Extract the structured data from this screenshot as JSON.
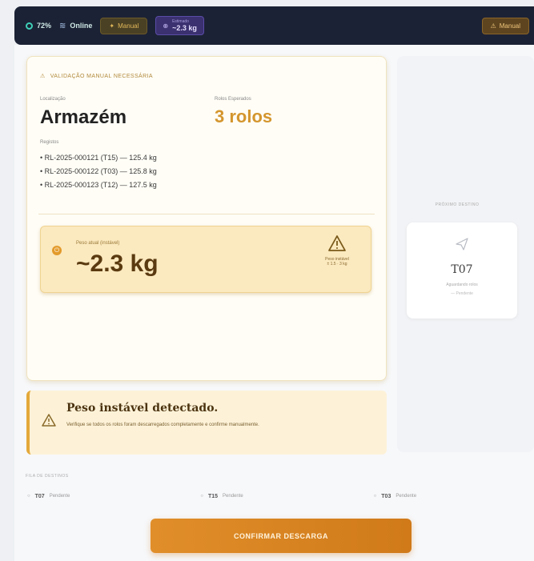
{
  "topbar": {
    "battery": "72%",
    "status": "Online",
    "manual_label": "Manual",
    "estimate_label": "Estimado",
    "estimate_value": "~2.3 kg",
    "right_label": "Manual"
  },
  "card": {
    "header": "VALIDAÇÃO MANUAL NECESSÁRIA",
    "location_label": "Localização",
    "location": "Armazém",
    "rolls_label": "Rolos Esperados",
    "rolls": "3 rolos",
    "rolls_list_label": "Registos",
    "rolls_list": [
      "• RL-2025-000121 (T15) — 125.4 kg",
      "• RL-2025-000122 (T03) — 125.8 kg",
      "• RL-2025-000123 (T12) — 127.5 kg"
    ],
    "weight_label": "Peso atual (instável)",
    "weight_value": "~2.3 kg",
    "weight_warn_1": "Peso instável",
    "weight_warn_2": "± 1.5 · 3 kg"
  },
  "side": {
    "label": "PRÓXIMO DESTINO",
    "code": "T07",
    "sub1": "Aguardando rolos",
    "sub2": "— Pendente"
  },
  "alert": {
    "title": "Peso instável detectado.",
    "text": "Verifique se todos os rolos foram descarregados completamente e confirme manualmente."
  },
  "tracks": {
    "label": "FILA DE DESTINOS",
    "items": [
      {
        "code": "T07",
        "status": "Pendente"
      },
      {
        "code": "T15",
        "status": "Pendente"
      },
      {
        "code": "T03",
        "status": "Pendente"
      }
    ]
  },
  "confirm_label": "CONFIRMAR DESCARGA",
  "colors": {
    "accent": "#e08e2a",
    "topbar": "#1c2235",
    "warning": "#e4a93a"
  }
}
